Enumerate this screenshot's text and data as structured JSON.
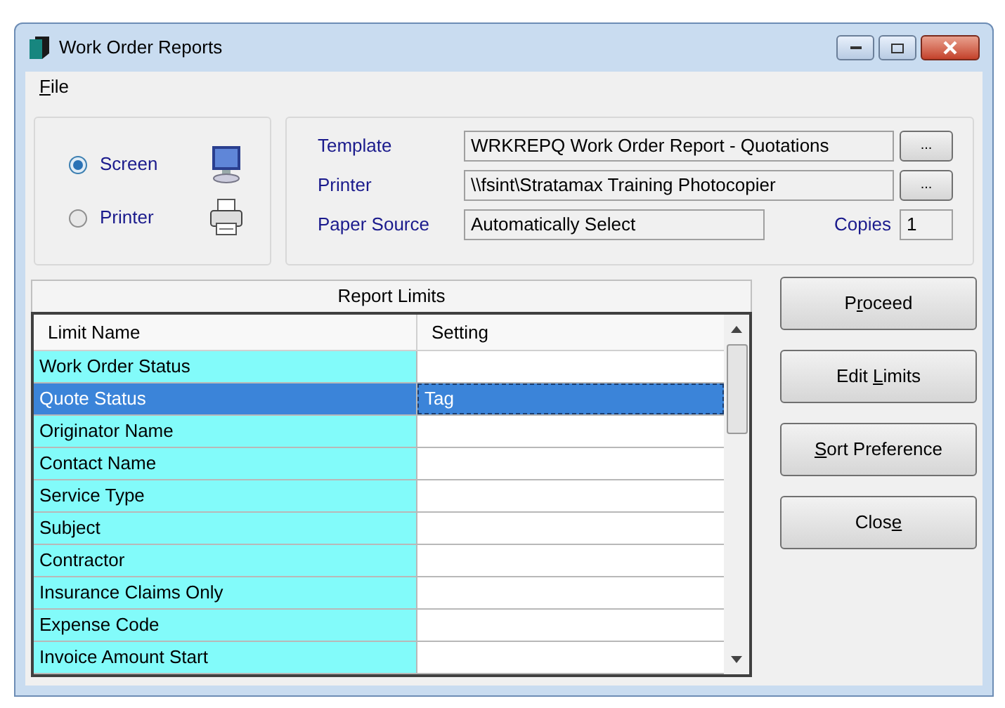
{
  "window": {
    "title": "Work Order Reports"
  },
  "menu": [
    {
      "key": "F",
      "after": "ile"
    }
  ],
  "output": [
    {
      "label": "Screen",
      "selected": true,
      "kind": "screen"
    },
    {
      "label": "Printer",
      "selected": false,
      "kind": "printer"
    }
  ],
  "settings": {
    "template_label": "Template",
    "template": "WRKREPQ Work Order Report - Quotations",
    "browse_template": "...",
    "printer_label": "Printer",
    "printer": "\\\\fsint\\Stratamax Training Photocopier",
    "browse_printer": "...",
    "paper_source_label": "Paper Source",
    "paper_source": "Automatically Select",
    "copies_label": "Copies",
    "copies": "1"
  },
  "table": {
    "title": "Report Limits",
    "columns": [
      "Limit Name",
      "Setting"
    ],
    "rows": [
      {
        "name": "Work Order Status",
        "setting": "",
        "selected": false
      },
      {
        "name": "Quote Status",
        "setting": "Tag",
        "selected": true
      },
      {
        "name": "Originator Name",
        "setting": "",
        "selected": false
      },
      {
        "name": "Contact Name",
        "setting": "",
        "selected": false
      },
      {
        "name": "Service Type",
        "setting": "",
        "selected": false
      },
      {
        "name": "Subject",
        "setting": "",
        "selected": false
      },
      {
        "name": "Contractor",
        "setting": "",
        "selected": false
      },
      {
        "name": "Insurance Claims Only",
        "setting": "",
        "selected": false
      },
      {
        "name": "Expense Code",
        "setting": "",
        "selected": false
      },
      {
        "name": "Invoice Amount Start",
        "setting": "",
        "selected": false
      }
    ]
  },
  "buttons": [
    {
      "before": "P",
      "key": "r",
      "after": "oceed"
    },
    {
      "before": "Edit ",
      "key": "L",
      "after": "imits"
    },
    {
      "key": "S",
      "after": "ort Preference"
    },
    {
      "before": "Clos",
      "key": "e"
    }
  ]
}
